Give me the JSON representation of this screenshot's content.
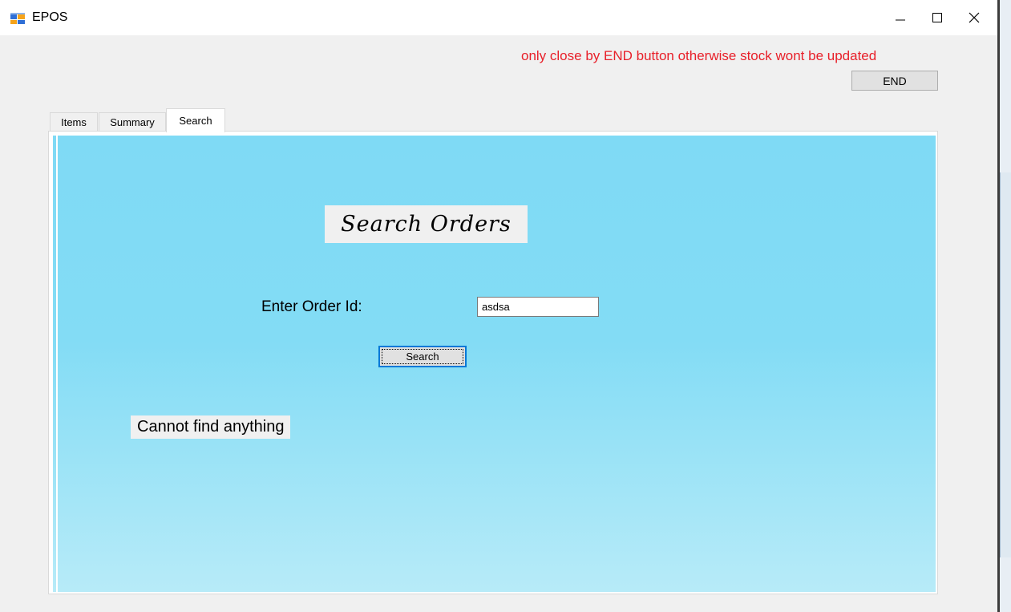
{
  "window": {
    "title": "EPOS",
    "icons": {
      "app": "app-window-icon",
      "minimize": "minimize-icon",
      "maximize": "maximize-icon",
      "close": "close-icon"
    }
  },
  "header": {
    "warning_text": "only close by END button otherwise stock wont be updated",
    "end_button": "END",
    "warning_color": "#e8202a"
  },
  "tabs": [
    {
      "label": "Items",
      "active": false
    },
    {
      "label": "Summary",
      "active": false
    },
    {
      "label": "Search",
      "active": true
    }
  ],
  "search_tab": {
    "heading": "Search Orders",
    "order_label": "Enter Order Id:",
    "order_input_value": "asdsa",
    "search_button": "Search",
    "result_text": "Cannot find anything",
    "background_colors": [
      "#7fdaf5",
      "#b7ebf8"
    ]
  }
}
